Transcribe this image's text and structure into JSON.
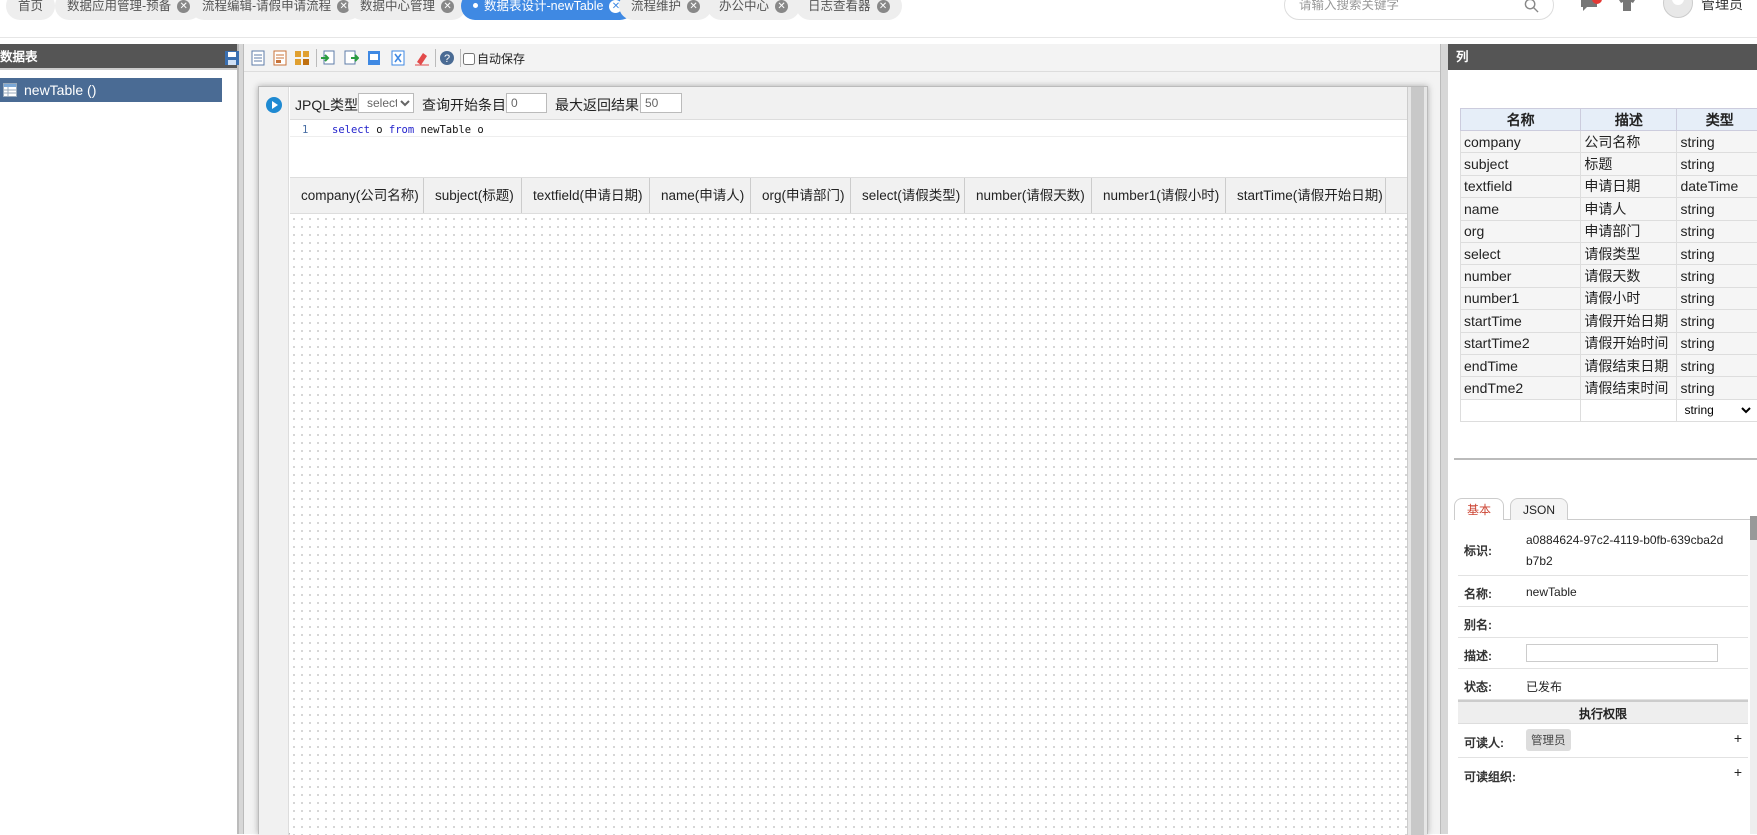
{
  "topbar": {
    "tabs": [
      {
        "label": "首页",
        "closable": false
      },
      {
        "label": "数据应用管理-预备",
        "closable": true
      },
      {
        "label": "流程编辑-请假申请流程",
        "closable": true
      },
      {
        "label": "数据中心管理",
        "closable": true
      },
      {
        "label": "数据表设计-newTable",
        "closable": true,
        "active": true
      },
      {
        "label": "流程维护",
        "closable": true
      },
      {
        "label": "办公中心",
        "closable": true
      },
      {
        "label": "日志查看器",
        "closable": true
      }
    ],
    "search_placeholder": "请输入搜索关键字",
    "user_name": "管理员"
  },
  "left_panel": {
    "title": "数据表",
    "tree_item": "newTable ()"
  },
  "toolbar": {
    "autosave_label": "自动保存",
    "autosave_checked": false
  },
  "query": {
    "type_label": "JPQL类型",
    "type_value": "select",
    "start_label": "查询开始条目",
    "start_value": "0",
    "max_label": "最大返回结果",
    "max_value": "50",
    "line_number": "1",
    "code_kw1": "select",
    "code_mid": " o ",
    "code_kw2": "from",
    "code_rest": " newTable o"
  },
  "result_columns": [
    "company(公司名称)",
    "subject(标题)",
    "textfield(申请日期)",
    "name(申请人)",
    "org(申请部门)",
    "select(请假类型)",
    "number(请假天数)",
    "number1(请假小时)",
    "startTime(请假开始日期)"
  ],
  "right_panel": {
    "title": "列",
    "headers": [
      "名称",
      "描述",
      "类型"
    ],
    "rows": [
      [
        "company",
        "公司名称",
        "string"
      ],
      [
        "subject",
        "标题",
        "string"
      ],
      [
        "textfield",
        "申请日期",
        "dateTime"
      ],
      [
        "name",
        "申请人",
        "string"
      ],
      [
        "org",
        "申请部门",
        "string"
      ],
      [
        "select",
        "请假类型",
        "string"
      ],
      [
        "number",
        "请假天数",
        "string"
      ],
      [
        "number1",
        "请假小时",
        "string"
      ],
      [
        "startTime",
        "请假开始日期",
        "string"
      ],
      [
        "startTime2",
        "请假开始时间",
        "string"
      ],
      [
        "endTime",
        "请假结束日期",
        "string"
      ],
      [
        "endTme2",
        "请假结束时间",
        "string"
      ]
    ],
    "new_row_type": "string",
    "prop_tabs": [
      "基本",
      "JSON"
    ],
    "props": {
      "id_label": "标识:",
      "id_value": "a0884624-97c2-4119-b0fb-639cba2db7b2",
      "name_label": "名称:",
      "name_value": "newTable",
      "alias_label": "别名:",
      "alias_value": "",
      "desc_label": "描述:",
      "desc_value": "",
      "status_label": "状态:",
      "status_value": "已发布",
      "section_title": "执行权限",
      "readers_label": "可读人:",
      "readers_value": "管理员",
      "reader_orgs_label": "可读组织:"
    }
  }
}
